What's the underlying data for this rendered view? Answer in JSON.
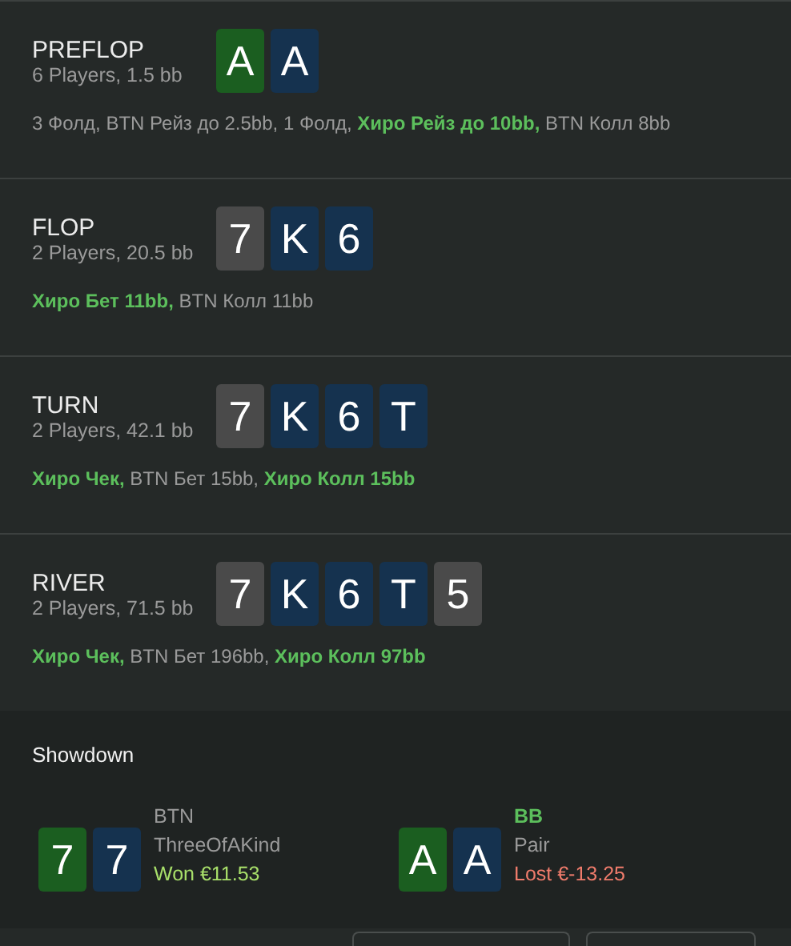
{
  "streets": [
    {
      "title": "PREFLOP",
      "info": "6 Players, 1.5 bb",
      "cards": [
        {
          "rank": "A",
          "color": "#1b5e20"
        },
        {
          "rank": "A",
          "color": "#15324f"
        }
      ],
      "actions": "3 Фолд, BTN Рейз до 2.5bb, 1 Фолд, **Хиро Рейз до 10bb,** BTN Колл 8bb"
    },
    {
      "title": "FLOP",
      "info": "2 Players, 20.5 bb",
      "cards": [
        {
          "rank": "7",
          "color": "#4a4a4a"
        },
        {
          "rank": "K",
          "color": "#15324f"
        },
        {
          "rank": "6",
          "color": "#15324f"
        }
      ],
      "actions": "**Хиро Бет 11bb,** BTN Колл 11bb"
    },
    {
      "title": "TURN",
      "info": "2 Players, 42.1 bb",
      "cards": [
        {
          "rank": "7",
          "color": "#4a4a4a"
        },
        {
          "rank": "K",
          "color": "#15324f"
        },
        {
          "rank": "6",
          "color": "#15324f"
        },
        {
          "rank": "T",
          "color": "#15324f"
        }
      ],
      "actions": "**Хиро Чек,** BTN Бет 15bb, **Хиро Колл 15bb**"
    },
    {
      "title": "RIVER",
      "info": "2 Players, 71.5 bb",
      "cards": [
        {
          "rank": "7",
          "color": "#4a4a4a"
        },
        {
          "rank": "K",
          "color": "#15324f"
        },
        {
          "rank": "6",
          "color": "#15324f"
        },
        {
          "rank": "T",
          "color": "#15324f"
        },
        {
          "rank": "5",
          "color": "#4a4a4a"
        }
      ],
      "actions": "**Хиро Чек,** BTN Бет 196bb, **Хиро Колл 97bb**"
    }
  ],
  "showdown": {
    "title": "Showdown",
    "players": [
      {
        "name": "BTN",
        "hero": false,
        "hand": "ThreeOfAKind",
        "result": "Won €11.53",
        "won": true,
        "cards": [
          {
            "rank": "7",
            "color": "#1b5e20"
          },
          {
            "rank": "7",
            "color": "#15324f"
          }
        ]
      },
      {
        "name": "BB",
        "hero": true,
        "hand": "Pair",
        "result": "Lost €-13.25",
        "won": false,
        "cards": [
          {
            "rank": "A",
            "color": "#1b5e20"
          },
          {
            "rank": "A",
            "color": "#15324f"
          }
        ]
      }
    ]
  }
}
